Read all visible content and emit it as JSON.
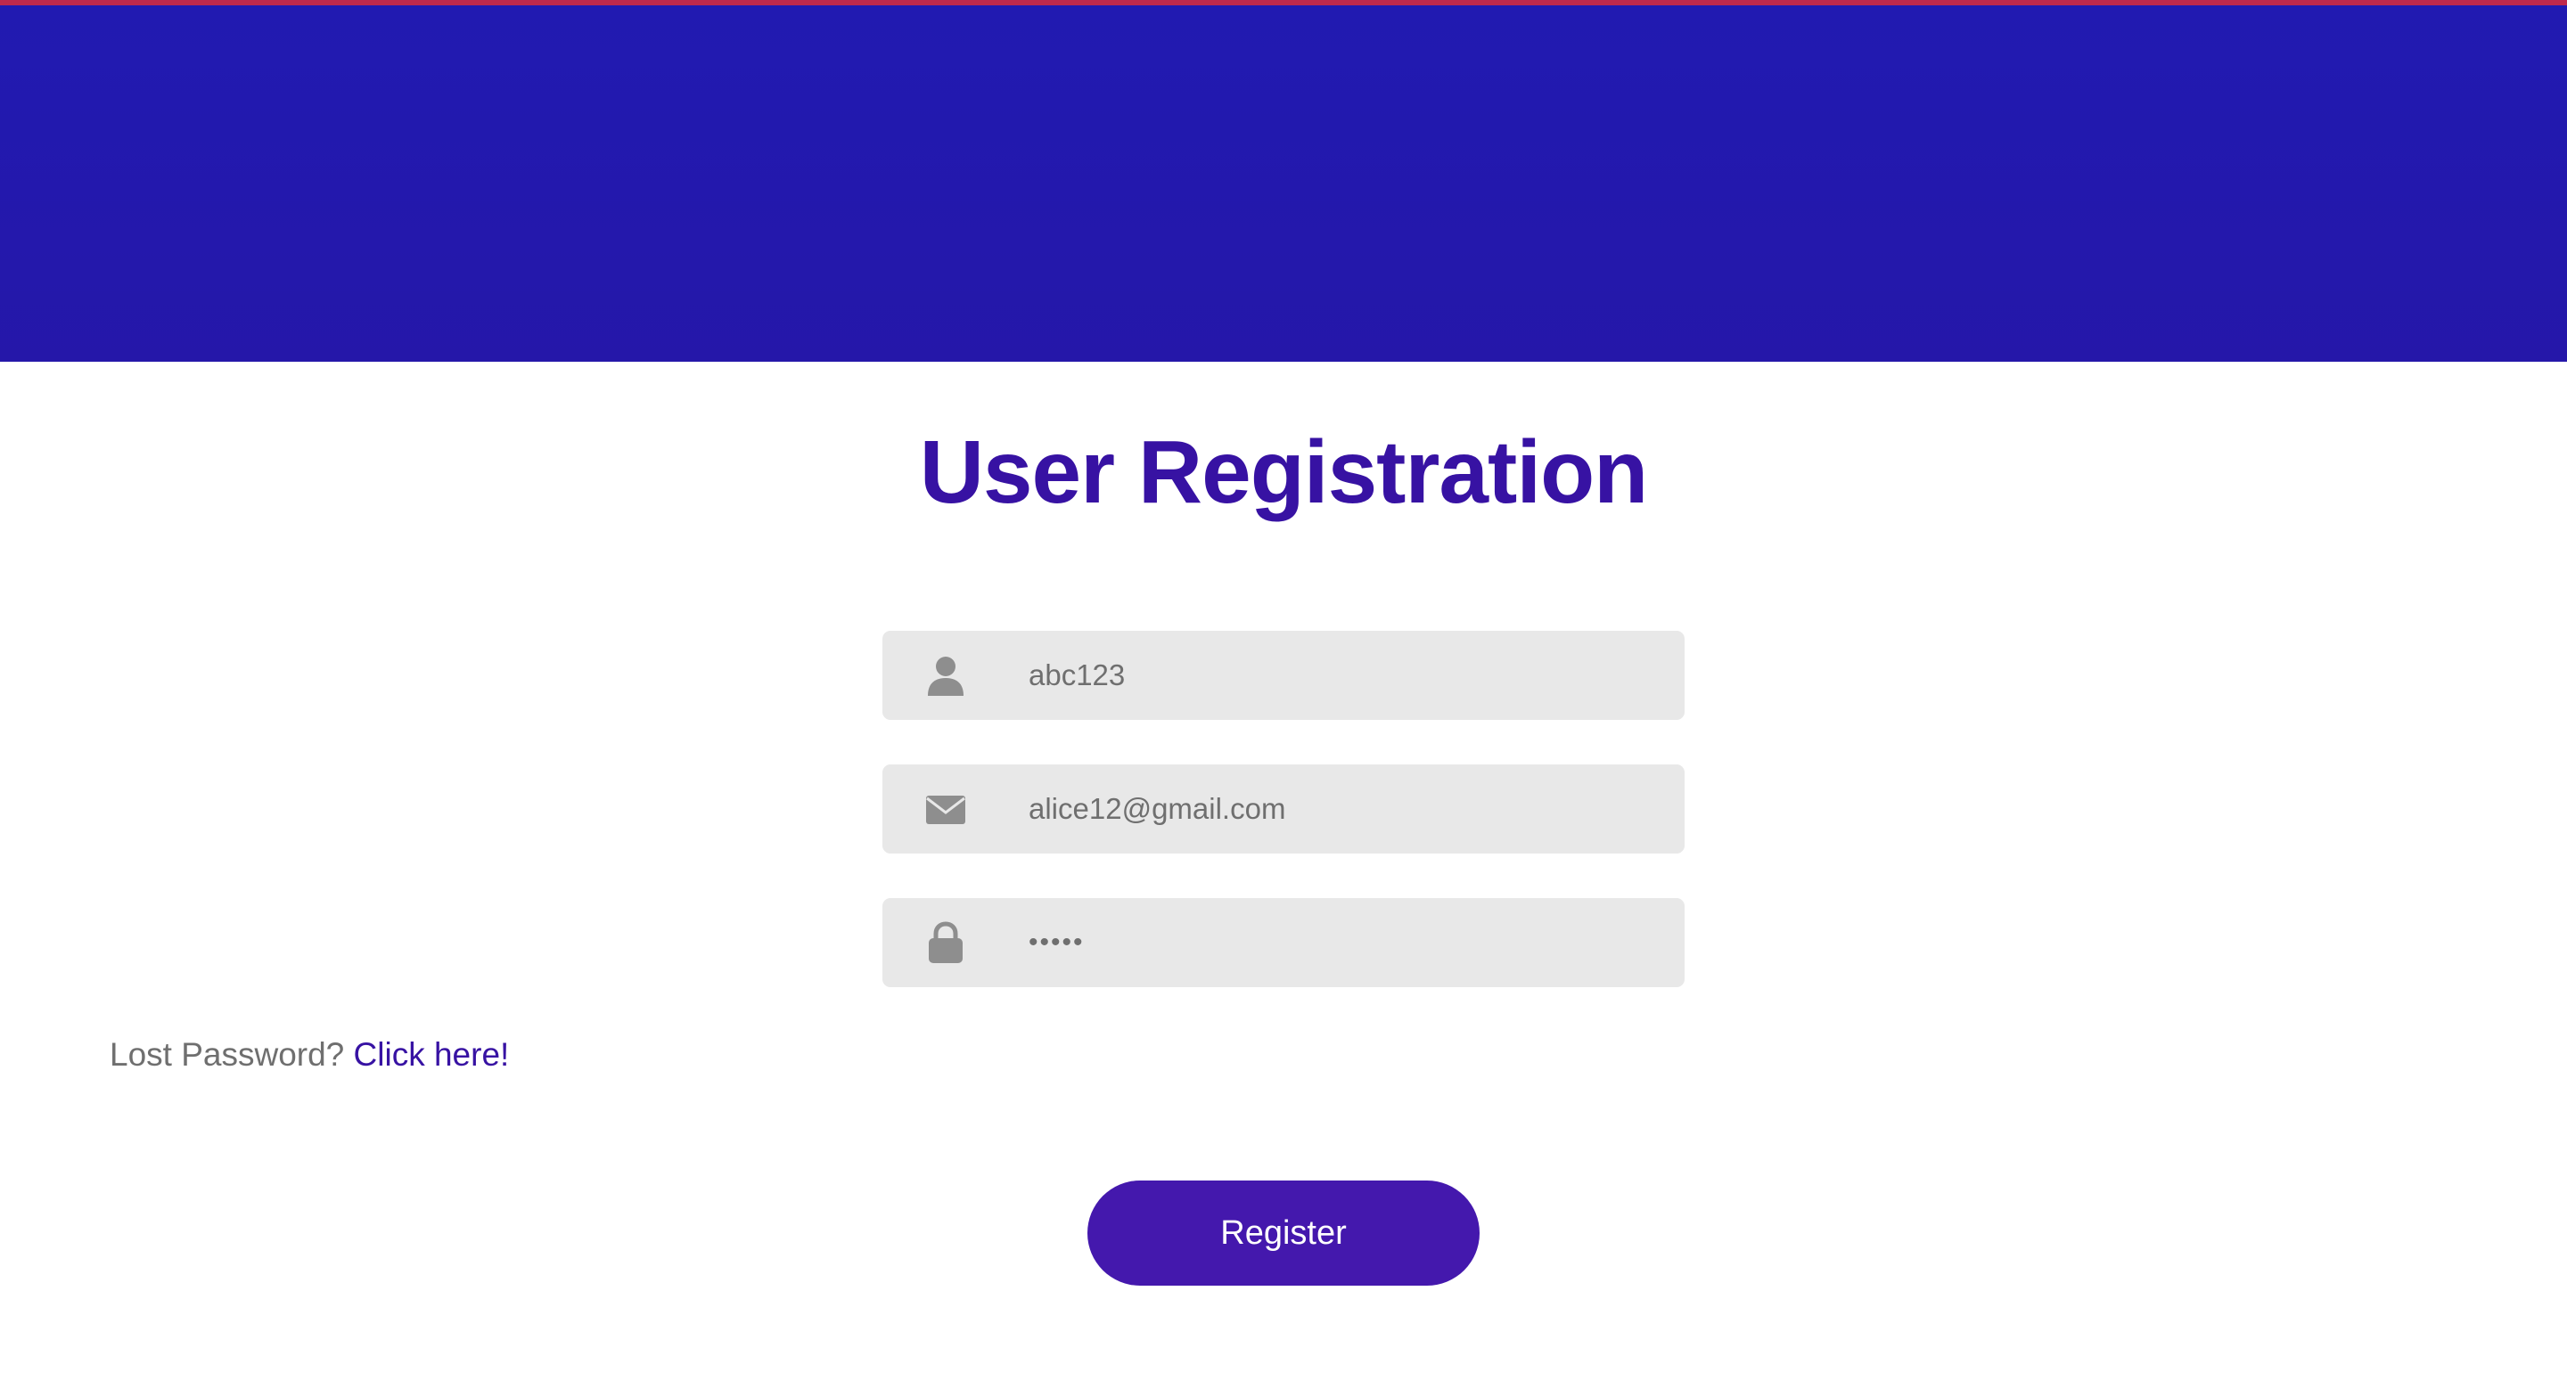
{
  "page": {
    "title": "User Registration"
  },
  "form": {
    "username": {
      "value": "abc123",
      "icon": "user-icon"
    },
    "email": {
      "value": "alice12@gmail.com",
      "icon": "envelope-icon"
    },
    "password": {
      "value": "•••••",
      "icon": "lock-icon"
    }
  },
  "lost_password": {
    "prompt": "Lost Password?",
    "link_label": "Click here!"
  },
  "register_button": {
    "label": "Register"
  },
  "colors": {
    "banner": "#211ab1",
    "accent": "#3712a3",
    "button": "#4418ad",
    "field_background": "#e8e8e8",
    "top_line": "#c0294c"
  }
}
